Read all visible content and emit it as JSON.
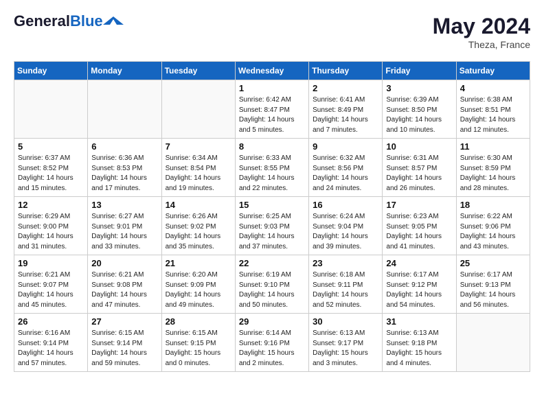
{
  "header": {
    "logo_line1": "General",
    "logo_line2": "Blue",
    "month_year": "May 2024",
    "location": "Theza, France"
  },
  "days_of_week": [
    "Sunday",
    "Monday",
    "Tuesday",
    "Wednesday",
    "Thursday",
    "Friday",
    "Saturday"
  ],
  "weeks": [
    [
      {
        "day": "",
        "content": ""
      },
      {
        "day": "",
        "content": ""
      },
      {
        "day": "",
        "content": ""
      },
      {
        "day": "1",
        "content": "Sunrise: 6:42 AM\nSunset: 8:47 PM\nDaylight: 14 hours\nand 5 minutes."
      },
      {
        "day": "2",
        "content": "Sunrise: 6:41 AM\nSunset: 8:49 PM\nDaylight: 14 hours\nand 7 minutes."
      },
      {
        "day": "3",
        "content": "Sunrise: 6:39 AM\nSunset: 8:50 PM\nDaylight: 14 hours\nand 10 minutes."
      },
      {
        "day": "4",
        "content": "Sunrise: 6:38 AM\nSunset: 8:51 PM\nDaylight: 14 hours\nand 12 minutes."
      }
    ],
    [
      {
        "day": "5",
        "content": "Sunrise: 6:37 AM\nSunset: 8:52 PM\nDaylight: 14 hours\nand 15 minutes."
      },
      {
        "day": "6",
        "content": "Sunrise: 6:36 AM\nSunset: 8:53 PM\nDaylight: 14 hours\nand 17 minutes."
      },
      {
        "day": "7",
        "content": "Sunrise: 6:34 AM\nSunset: 8:54 PM\nDaylight: 14 hours\nand 19 minutes."
      },
      {
        "day": "8",
        "content": "Sunrise: 6:33 AM\nSunset: 8:55 PM\nDaylight: 14 hours\nand 22 minutes."
      },
      {
        "day": "9",
        "content": "Sunrise: 6:32 AM\nSunset: 8:56 PM\nDaylight: 14 hours\nand 24 minutes."
      },
      {
        "day": "10",
        "content": "Sunrise: 6:31 AM\nSunset: 8:57 PM\nDaylight: 14 hours\nand 26 minutes."
      },
      {
        "day": "11",
        "content": "Sunrise: 6:30 AM\nSunset: 8:59 PM\nDaylight: 14 hours\nand 28 minutes."
      }
    ],
    [
      {
        "day": "12",
        "content": "Sunrise: 6:29 AM\nSunset: 9:00 PM\nDaylight: 14 hours\nand 31 minutes."
      },
      {
        "day": "13",
        "content": "Sunrise: 6:27 AM\nSunset: 9:01 PM\nDaylight: 14 hours\nand 33 minutes."
      },
      {
        "day": "14",
        "content": "Sunrise: 6:26 AM\nSunset: 9:02 PM\nDaylight: 14 hours\nand 35 minutes."
      },
      {
        "day": "15",
        "content": "Sunrise: 6:25 AM\nSunset: 9:03 PM\nDaylight: 14 hours\nand 37 minutes."
      },
      {
        "day": "16",
        "content": "Sunrise: 6:24 AM\nSunset: 9:04 PM\nDaylight: 14 hours\nand 39 minutes."
      },
      {
        "day": "17",
        "content": "Sunrise: 6:23 AM\nSunset: 9:05 PM\nDaylight: 14 hours\nand 41 minutes."
      },
      {
        "day": "18",
        "content": "Sunrise: 6:22 AM\nSunset: 9:06 PM\nDaylight: 14 hours\nand 43 minutes."
      }
    ],
    [
      {
        "day": "19",
        "content": "Sunrise: 6:21 AM\nSunset: 9:07 PM\nDaylight: 14 hours\nand 45 minutes."
      },
      {
        "day": "20",
        "content": "Sunrise: 6:21 AM\nSunset: 9:08 PM\nDaylight: 14 hours\nand 47 minutes."
      },
      {
        "day": "21",
        "content": "Sunrise: 6:20 AM\nSunset: 9:09 PM\nDaylight: 14 hours\nand 49 minutes."
      },
      {
        "day": "22",
        "content": "Sunrise: 6:19 AM\nSunset: 9:10 PM\nDaylight: 14 hours\nand 50 minutes."
      },
      {
        "day": "23",
        "content": "Sunrise: 6:18 AM\nSunset: 9:11 PM\nDaylight: 14 hours\nand 52 minutes."
      },
      {
        "day": "24",
        "content": "Sunrise: 6:17 AM\nSunset: 9:12 PM\nDaylight: 14 hours\nand 54 minutes."
      },
      {
        "day": "25",
        "content": "Sunrise: 6:17 AM\nSunset: 9:13 PM\nDaylight: 14 hours\nand 56 minutes."
      }
    ],
    [
      {
        "day": "26",
        "content": "Sunrise: 6:16 AM\nSunset: 9:14 PM\nDaylight: 14 hours\nand 57 minutes."
      },
      {
        "day": "27",
        "content": "Sunrise: 6:15 AM\nSunset: 9:14 PM\nDaylight: 14 hours\nand 59 minutes."
      },
      {
        "day": "28",
        "content": "Sunrise: 6:15 AM\nSunset: 9:15 PM\nDaylight: 15 hours\nand 0 minutes."
      },
      {
        "day": "29",
        "content": "Sunrise: 6:14 AM\nSunset: 9:16 PM\nDaylight: 15 hours\nand 2 minutes."
      },
      {
        "day": "30",
        "content": "Sunrise: 6:13 AM\nSunset: 9:17 PM\nDaylight: 15 hours\nand 3 minutes."
      },
      {
        "day": "31",
        "content": "Sunrise: 6:13 AM\nSunset: 9:18 PM\nDaylight: 15 hours\nand 4 minutes."
      },
      {
        "day": "",
        "content": ""
      }
    ]
  ]
}
